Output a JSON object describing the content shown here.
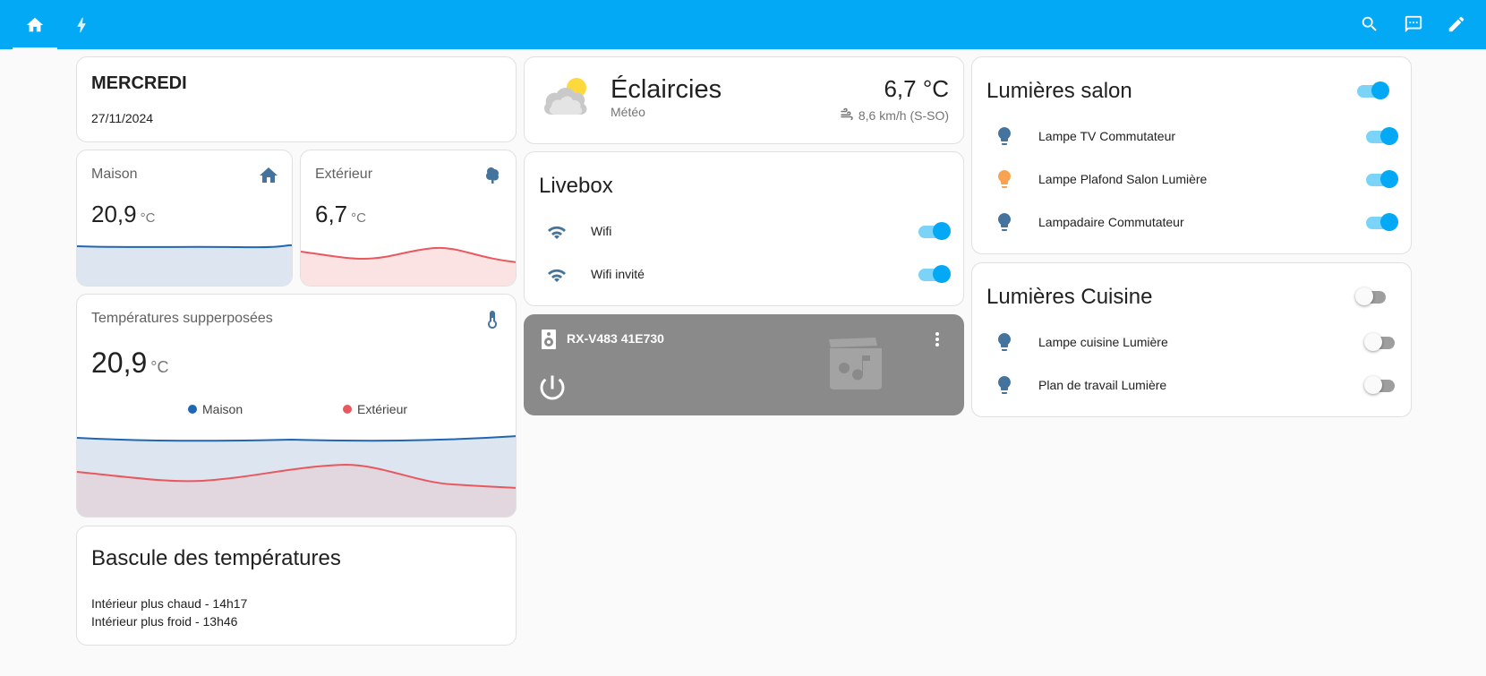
{
  "header": {
    "tabs": [
      {
        "icon": "home-icon",
        "active": true
      },
      {
        "icon": "lightning-icon",
        "active": false
      }
    ],
    "actions": [
      "search-icon",
      "assist-icon",
      "edit-icon"
    ]
  },
  "date_card": {
    "day": "MERCREDI",
    "date": "27/11/2024"
  },
  "maison": {
    "name": "Maison",
    "value": "20,9",
    "unit": "°C",
    "icon": "home-icon"
  },
  "exterieur": {
    "name": "Extérieur",
    "value": "6,7",
    "unit": "°C",
    "icon": "tree-icon"
  },
  "superposees": {
    "name": "Températures supperposées",
    "value": "20,9",
    "unit": "°C",
    "icon": "thermometer-icon",
    "legend": [
      {
        "name": "Maison",
        "color": "#1f66b3"
      },
      {
        "name": "Extérieur",
        "color": "#e8585f"
      }
    ]
  },
  "bascule": {
    "title": "Bascule des températures",
    "lines": [
      "Intérieur plus chaud - 14h17",
      "Intérieur plus froid - 13h46"
    ]
  },
  "weather": {
    "condition": "Éclaircies",
    "subtitle": "Météo",
    "temperature": "6,7 °C",
    "wind": "8,6 km/h (S-SO)",
    "icon": "partly-cloudy-icon"
  },
  "livebox": {
    "title": "Livebox",
    "items": [
      {
        "label": "Wifi",
        "on": true
      },
      {
        "label": "Wifi invité",
        "on": true
      }
    ]
  },
  "media": {
    "name": "RX-V483 41E730",
    "state": "off"
  },
  "salon": {
    "title": "Lumières salon",
    "master_on": true,
    "items": [
      {
        "label": "Lampe TV Commutateur",
        "on": true,
        "color": "#44739e"
      },
      {
        "label": "Lampe Plafond Salon Lumière",
        "on": true,
        "color": "#f7a351"
      },
      {
        "label": "Lampadaire Commutateur",
        "on": true,
        "color": "#44739e"
      }
    ]
  },
  "cuisine": {
    "title": "Lumières Cuisine",
    "master_on": false,
    "items": [
      {
        "label": "Lampe cuisine Lumière",
        "on": false,
        "color": "#44739e"
      },
      {
        "label": "Plan de travail Lumière",
        "on": false,
        "color": "#44739e"
      }
    ]
  },
  "colors": {
    "header": "#03a9f4",
    "accent": "#03a9f4",
    "icon": "#44739e"
  }
}
